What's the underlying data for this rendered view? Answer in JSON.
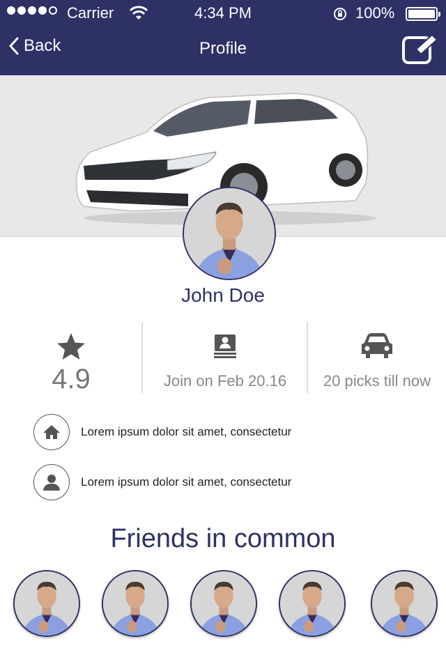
{
  "status_bar": {
    "carrier": "Carrier",
    "time": "4:34 PM",
    "battery": "100%"
  },
  "nav": {
    "back_label": "Back",
    "title": "Profile",
    "edit_icon": "edit-icon"
  },
  "profile": {
    "name": "John Doe",
    "rating": "4.9",
    "joined": "Join on Feb 20.16",
    "picks": "20 picks till now"
  },
  "info": [
    {
      "icon": "home-icon",
      "text": "Lorem ipsum dolor sit amet, consectetur"
    },
    {
      "icon": "person-icon",
      "text": "Lorem ipsum dolor sit amet, consectetur"
    }
  ],
  "friends": {
    "title": "Friends in common"
  },
  "colors": {
    "header_bg": "#2e3166",
    "accent": "#2e3166",
    "hero_bg": "#e8e8e8"
  }
}
